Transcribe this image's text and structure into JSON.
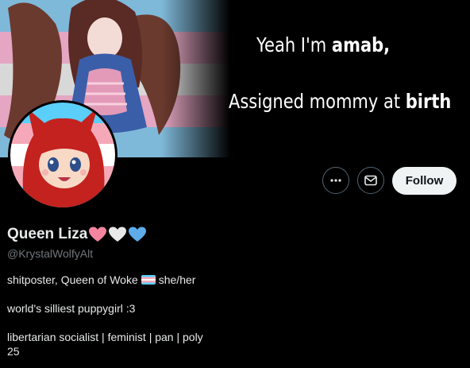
{
  "banner": {
    "line1_regular": "Yeah I'm ",
    "line1_bold": "amab,",
    "line2_regular": "Assigned mommy at ",
    "line2_bold": "birth"
  },
  "actions": {
    "follow_label": "Follow"
  },
  "profile": {
    "display_name": "Queen Liza",
    "hearts": [
      "pink-heart",
      "white-heart",
      "light-blue-heart"
    ],
    "handle": "@KrystalWolfyAlt"
  },
  "bio": {
    "line1_before_flag": "shitposter, Queen of Woke",
    "line1_flag": "transgender-flag",
    "line1_after_flag": "she/her",
    "line2": "world's silliest puppygirl :3",
    "line3": "libertarian socialist | feminist | pan | poly",
    "line4": "25"
  },
  "colors": {
    "background": "#000000",
    "follow_bg": "#eff3f4",
    "handle": "#71767b",
    "heart_pink": "#f4849f",
    "heart_white": "#e8e8e8",
    "heart_blue": "#5eacea"
  }
}
